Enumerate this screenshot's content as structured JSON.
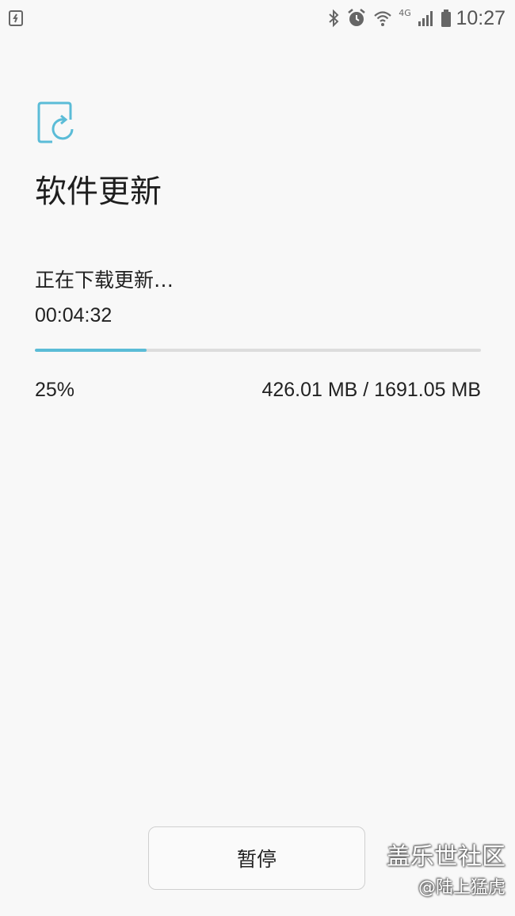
{
  "status_bar": {
    "time": "10:27",
    "network_type": "4G",
    "icons": [
      "update-notification-icon",
      "bluetooth-icon",
      "alarm-icon",
      "wifi-icon",
      "signal-icon",
      "battery-icon"
    ]
  },
  "header": {
    "icon": "software-update-icon",
    "title": "软件更新"
  },
  "download": {
    "status_text": "正在下载更新…",
    "elapsed_time": "00:04:32",
    "progress_fraction": 0.25,
    "percent_text": "25%",
    "size_text": "426.01 MB / 1691.05 MB"
  },
  "actions": {
    "pause_label": "暂停"
  },
  "watermark": {
    "line1": "盖乐世社区",
    "line2": "@陆上猛虎"
  },
  "colors": {
    "accent": "#5bbcd7",
    "track": "#dddddd",
    "background": "#f8f8f8"
  }
}
